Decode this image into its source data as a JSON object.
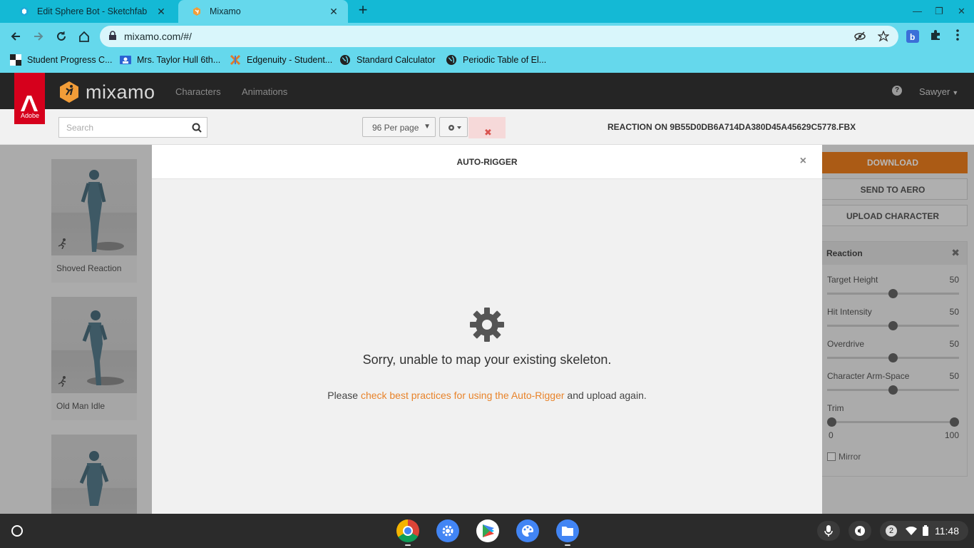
{
  "browser": {
    "tabs": [
      {
        "title": "Edit Sphere Bot - Sketchfab",
        "active": false
      },
      {
        "title": "Mixamo",
        "active": true
      }
    ],
    "url": "mixamo.com/#/",
    "bookmarks": [
      {
        "label": "Student Progress C..."
      },
      {
        "label": "Mrs. Taylor Hull 6th..."
      },
      {
        "label": "Edgenuity - Student..."
      },
      {
        "label": "Standard Calculator"
      },
      {
        "label": "Periodic Table of El..."
      }
    ]
  },
  "mixamo": {
    "adobe_label": "Adobe",
    "logo": "mixamo",
    "nav": {
      "characters": "Characters",
      "animations": "Animations"
    },
    "help": "?",
    "user": "Sawyer",
    "search_placeholder": "Search",
    "per_page": "96 Per page",
    "filename": "REACTION ON 9B55D0DB6A714DA380D45A45629C5778.FBX"
  },
  "animations": [
    {
      "name": "Shoved Reaction"
    },
    {
      "name": "Old Man Idle"
    },
    {
      "name": ""
    }
  ],
  "right_panel": {
    "download": "DOWNLOAD",
    "send_to_aero": "SEND TO AERO",
    "upload_character": "UPLOAD CHARACTER",
    "section_title": "Reaction",
    "sliders": [
      {
        "label": "Target Height",
        "value": "50",
        "level": 0.5
      },
      {
        "label": "Hit Intensity",
        "value": "50",
        "level": 0.5
      },
      {
        "label": "Overdrive",
        "value": "50",
        "level": 0.5
      },
      {
        "label": "Character Arm-Space",
        "value": "50",
        "level": 0.5
      }
    ],
    "trim": {
      "label": "Trim",
      "min": "0",
      "max": "100"
    },
    "mirror": "Mirror"
  },
  "modal": {
    "title": "AUTO-RIGGER",
    "close": "×",
    "message": "Sorry, unable to map your existing skeleton.",
    "sub_before": "Please ",
    "sub_link": "check best practices for using the Auto-Rigger",
    "sub_after": " and upload again."
  },
  "shelf": {
    "apps": [
      "chrome-icon",
      "settings-icon",
      "play-store-icon",
      "canvas-icon",
      "files-icon"
    ],
    "notification_count": "2",
    "time": "11:48"
  },
  "colors": {
    "accent": "#ee7f1e",
    "tabstrip": "#14b9d5",
    "toolbar": "#65d8ec",
    "header": "#252525",
    "adobe": "#d6001c"
  }
}
